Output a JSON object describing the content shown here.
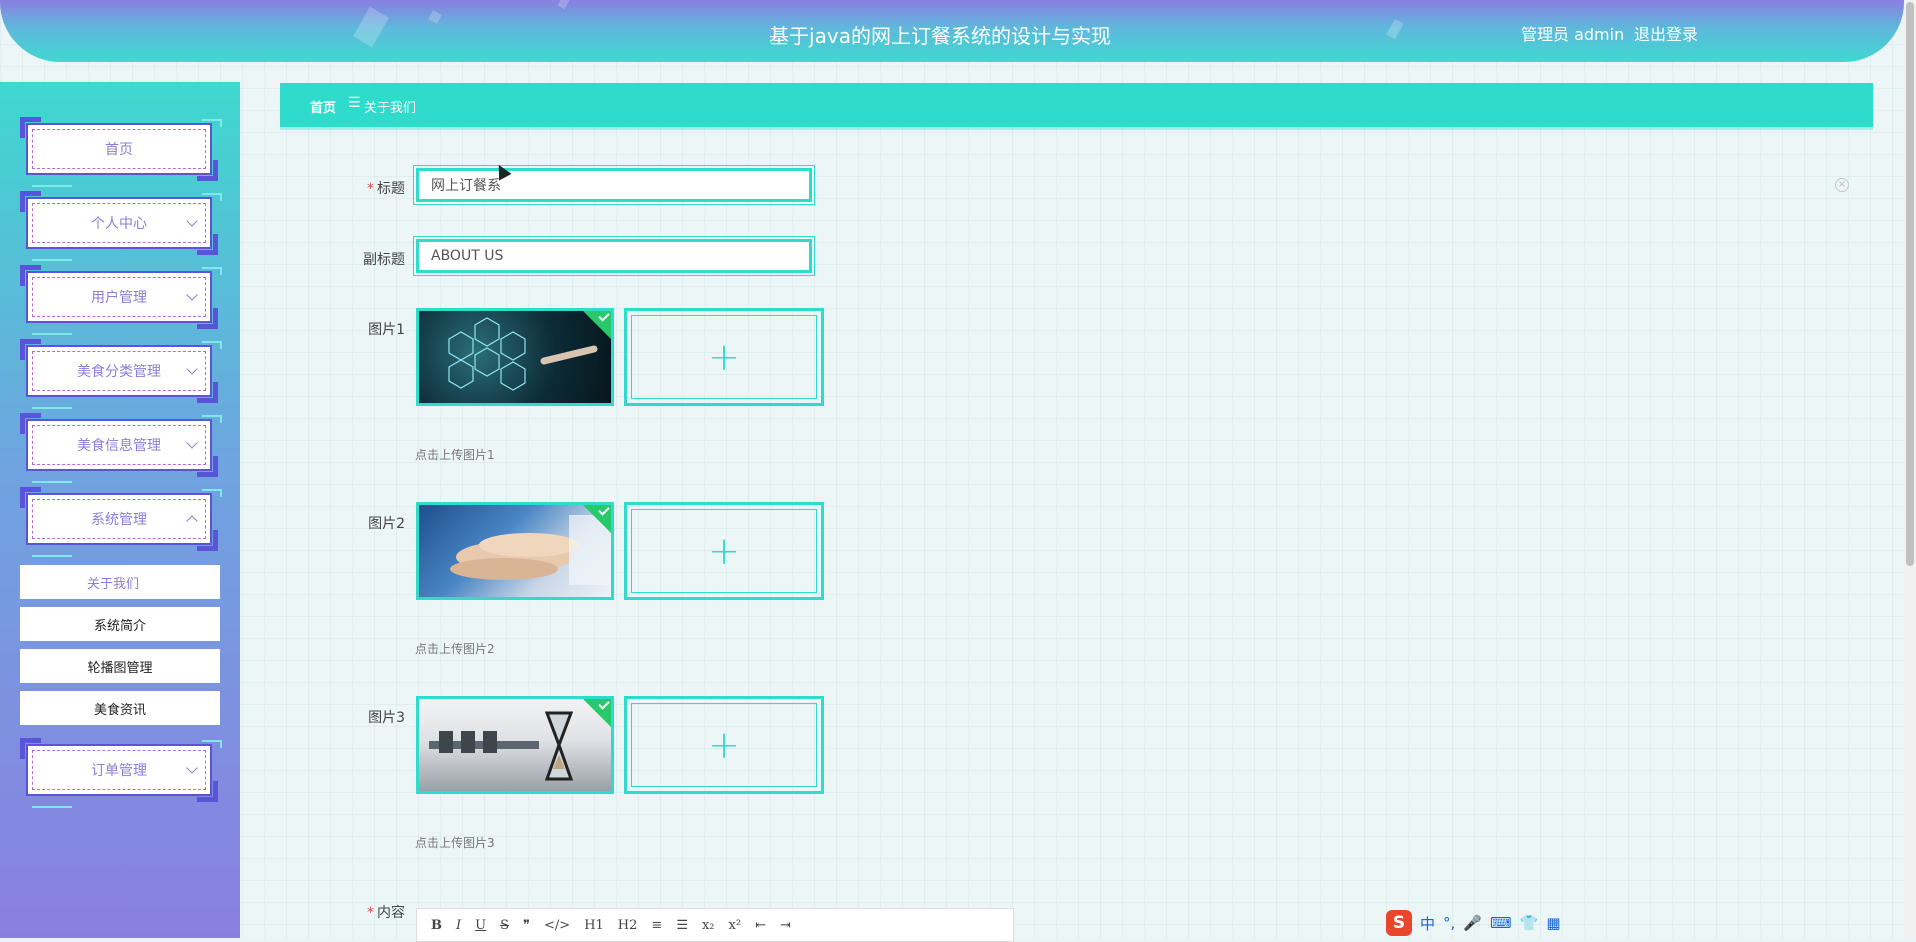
{
  "app": {
    "title": "基于java的网上订餐系统的设计与实现",
    "user_label": "管理员 admin",
    "logout_label": "退出登录"
  },
  "sidebar": {
    "menus": [
      {
        "label": "首页"
      },
      {
        "label": "个人中心"
      },
      {
        "label": "用户管理"
      },
      {
        "label": "美食分类管理"
      },
      {
        "label": "美食信息管理"
      },
      {
        "label": "系统管理"
      }
    ],
    "sub_items": [
      {
        "label": "关于我们"
      },
      {
        "label": "系统简介"
      },
      {
        "label": "轮播图管理"
      },
      {
        "label": "美食资讯"
      }
    ],
    "order_menu": {
      "label": "订单管理"
    }
  },
  "breadcrumb": {
    "home": "首页",
    "separator": "☰",
    "current": "关于我们"
  },
  "form": {
    "title": {
      "label": "标题",
      "value": "网上订餐系"
    },
    "subtitle": {
      "label": "副标题",
      "value": "ABOUT US"
    },
    "images": [
      {
        "label": "图片1",
        "tip": "点击上传图片1"
      },
      {
        "label": "图片2",
        "tip": "点击上传图片2"
      },
      {
        "label": "图片3",
        "tip": "点击上传图片3"
      }
    ],
    "content": {
      "label": "内容"
    },
    "plus": "+",
    "clear": "×"
  },
  "editor_toolbar": [
    "B",
    "I",
    "U",
    "S",
    "❞",
    "</>",
    "H1",
    "H2",
    "≡",
    "☰",
    "x₂",
    "x²",
    "⇤",
    "⇥"
  ],
  "ime": {
    "logo": "S",
    "lang": "中",
    "punct": "°,",
    "mic": "🎤",
    "kb": "⌨",
    "shirt": "👕",
    "grid": "▦"
  },
  "colors": {
    "accent": "#2fdccc",
    "purple": "#8a7fe0",
    "border": "#5a54d8"
  }
}
